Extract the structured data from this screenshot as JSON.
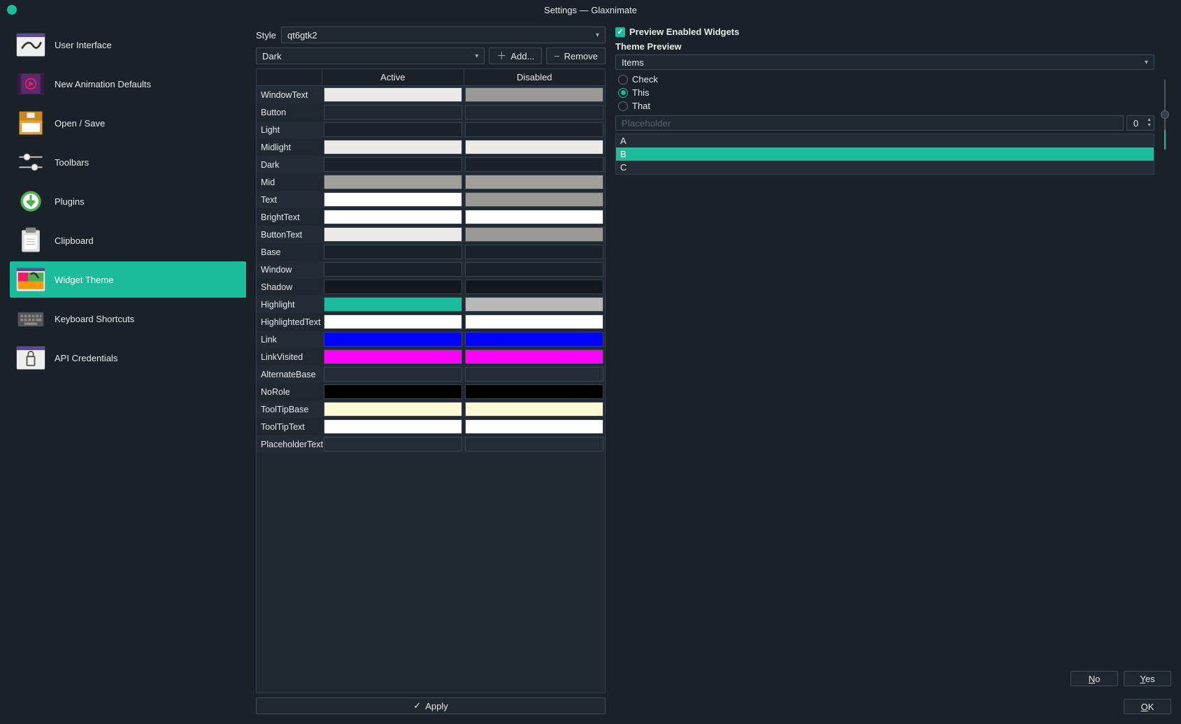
{
  "window": {
    "title": "Settings — Glaxnimate"
  },
  "sidebar": {
    "items": [
      {
        "label": "User Interface",
        "selected": false
      },
      {
        "label": "New Animation Defaults",
        "selected": false
      },
      {
        "label": "Open / Save",
        "selected": false
      },
      {
        "label": "Toolbars",
        "selected": false
      },
      {
        "label": "Plugins",
        "selected": false
      },
      {
        "label": "Clipboard",
        "selected": false
      },
      {
        "label": "Widget Theme",
        "selected": true
      },
      {
        "label": "Keyboard Shortcuts",
        "selected": false
      },
      {
        "label": "API Credentials",
        "selected": false
      }
    ]
  },
  "style": {
    "label": "Style",
    "value": "qt6gtk2"
  },
  "theme": {
    "selected": "Dark",
    "add_label": "Add...",
    "remove_label": "Remove"
  },
  "color_table": {
    "headers": {
      "active": "Active",
      "disabled": "Disabled"
    },
    "rows": [
      {
        "name": "WindowText",
        "active": "#eceae7",
        "disabled": "#9b9995"
      },
      {
        "name": "Button",
        "active": "#202833",
        "disabled": "#202833"
      },
      {
        "name": "Light",
        "active": "#1a2128",
        "disabled": "#1a2128"
      },
      {
        "name": "Midlight",
        "active": "#eceae7",
        "disabled": "#eceae7"
      },
      {
        "name": "Dark",
        "active": "#1a2128",
        "disabled": "#1a2128"
      },
      {
        "name": "Mid",
        "active": "#a09f9c",
        "disabled": "#a09f9c"
      },
      {
        "name": "Text",
        "active": "#ffffff",
        "disabled": "#9b9995"
      },
      {
        "name": "BrightText",
        "active": "#ffffff",
        "disabled": "#ffffff"
      },
      {
        "name": "ButtonText",
        "active": "#eceae7",
        "disabled": "#9b9995"
      },
      {
        "name": "Base",
        "active": "#1a2128",
        "disabled": "#1a2128"
      },
      {
        "name": "Window",
        "active": "#1a2128",
        "disabled": "#1a2128"
      },
      {
        "name": "Shadow",
        "active": "#13181f",
        "disabled": "#13181f"
      },
      {
        "name": "Highlight",
        "active": "#1abc9c",
        "disabled": "#b8b8b8"
      },
      {
        "name": "HighlightedText",
        "active": "#ffffff",
        "disabled": "#ffffff"
      },
      {
        "name": "Link",
        "active": "#0000ff",
        "disabled": "#0000ff"
      },
      {
        "name": "LinkVisited",
        "active": "#ff00ff",
        "disabled": "#ff00ff"
      },
      {
        "name": "AlternateBase",
        "active": "#232c36",
        "disabled": "#232c36"
      },
      {
        "name": "NoRole",
        "active": "#000000",
        "disabled": "#000000"
      },
      {
        "name": "ToolTipBase",
        "active": "#fdfbd5",
        "disabled": "#fdfbd5"
      },
      {
        "name": "ToolTipText",
        "active": "#ffffff",
        "disabled": "#ffffff"
      },
      {
        "name": "PlaceholderText",
        "active": "#232c36",
        "disabled": "#232c36"
      }
    ]
  },
  "apply_label": "Apply",
  "preview": {
    "checkbox_label": "Preview Enabled Widgets",
    "checked": true,
    "title": "Theme Preview",
    "dropdown_value": "Items",
    "radios": [
      {
        "label": "Check",
        "checked": false
      },
      {
        "label": "This",
        "checked": true
      },
      {
        "label": "That",
        "checked": false
      }
    ],
    "placeholder": "Placeholder",
    "spin_value": "0",
    "list": [
      {
        "label": "A",
        "selected": false
      },
      {
        "label": "B",
        "selected": true
      },
      {
        "label": "C",
        "selected": false
      }
    ]
  },
  "footer": {
    "no": "No",
    "yes": "Yes",
    "ok": "OK"
  }
}
